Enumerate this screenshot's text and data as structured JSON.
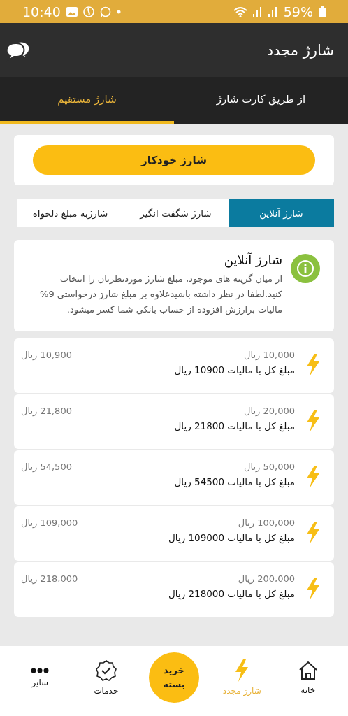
{
  "status_bar": {
    "time": "10:40",
    "battery": "59%"
  },
  "app_bar": {
    "title": "شارژ مجدد"
  },
  "tabs": [
    {
      "label": "از طریق کارت شارژ",
      "selected": false
    },
    {
      "label": "شارژ مستقیم",
      "selected": true
    }
  ],
  "auto_charge_button": "شارژ خودکار",
  "segments": [
    {
      "label": "شارژ آنلاین",
      "selected": true
    },
    {
      "label": "شارژ شگفت انگیز",
      "selected": false
    },
    {
      "label": "شارژبه مبلغ دلخواه",
      "selected": false
    }
  ],
  "info": {
    "title": "شارژ آنلاین",
    "text": "از میان گزینه های موجود، مبلغ شارژ موردنظرتان را انتخاب کنید.لطفا در نظر داشته باشیدعلاوه بر مبلغ شارژ درخواستی 9% مالیات برارزش افزوده از حساب بانکی شما کسر میشود."
  },
  "packages": [
    {
      "amount": "10,000 ریال",
      "total_text": "مبلغ کل با مالیات 10900 ریال",
      "price": "10,900 ریال"
    },
    {
      "amount": "20,000 ریال",
      "total_text": "مبلغ کل با مالیات 21800 ریال",
      "price": "21,800 ریال"
    },
    {
      "amount": "50,000 ریال",
      "total_text": "مبلغ کل با مالیات 54500 ریال",
      "price": "54,500 ریال"
    },
    {
      "amount": "100,000 ریال",
      "total_text": "مبلغ کل با مالیات 109000 ریال",
      "price": "109,000 ریال"
    },
    {
      "amount": "200,000 ریال",
      "total_text": "مبلغ کل با مالیات 218000 ریال",
      "price": "218,000 ریال"
    }
  ],
  "bottom_nav": [
    {
      "kind": "home",
      "label": "خانه",
      "selected": false
    },
    {
      "kind": "recharge",
      "label": "شارژ مجدد",
      "selected": true
    },
    {
      "kind": "center",
      "label": "خرید بسته",
      "selected": false
    },
    {
      "kind": "services",
      "label": "خدمات",
      "selected": false
    },
    {
      "kind": "more",
      "label": "سایر",
      "selected": false
    }
  ]
}
